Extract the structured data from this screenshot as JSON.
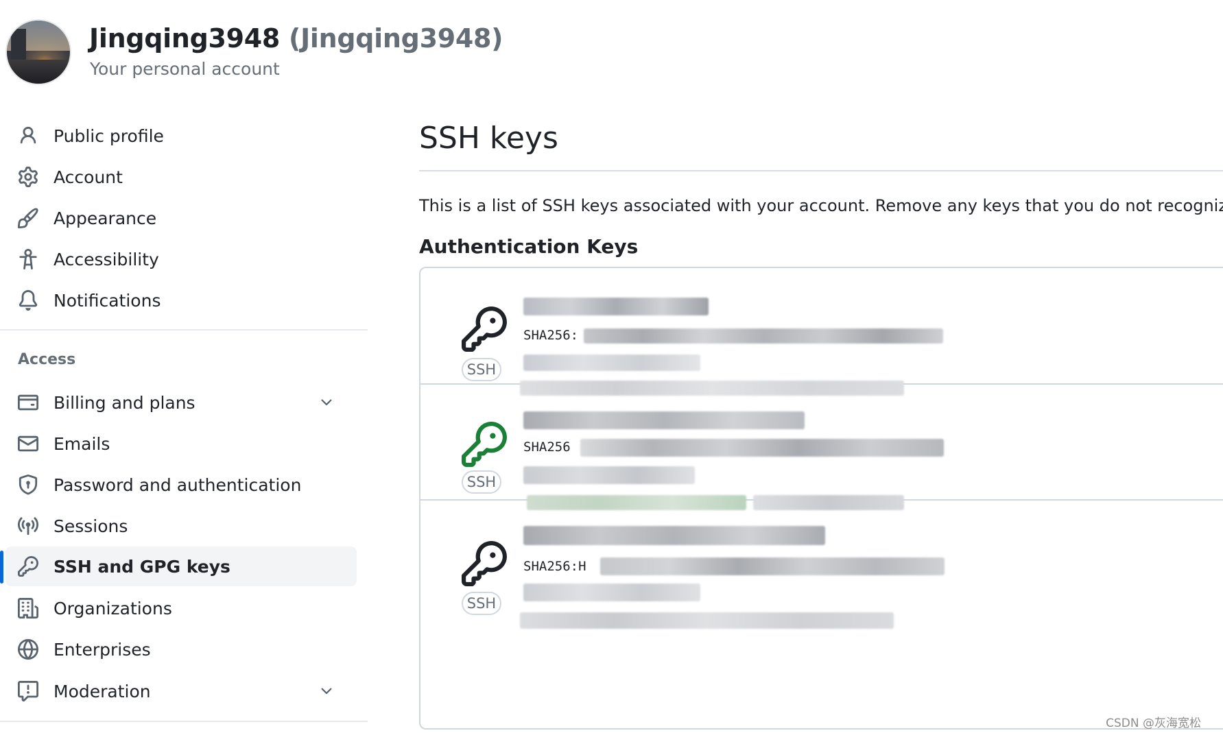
{
  "header": {
    "display_name": "Jingqing3948",
    "login": "(Jingqing3948)",
    "subtitle": "Your personal account"
  },
  "sidebar": {
    "items": [
      {
        "label": "Public profile",
        "icon": "person-icon"
      },
      {
        "label": "Account",
        "icon": "gear-icon"
      },
      {
        "label": "Appearance",
        "icon": "paintbrush-icon"
      },
      {
        "label": "Accessibility",
        "icon": "accessibility-icon"
      },
      {
        "label": "Notifications",
        "icon": "bell-icon"
      }
    ],
    "access_section": {
      "label": "Access",
      "items": [
        {
          "label": "Billing and plans",
          "icon": "credit-card-icon",
          "expandable": true
        },
        {
          "label": "Emails",
          "icon": "mail-icon"
        },
        {
          "label": "Password and authentication",
          "icon": "shield-lock-icon"
        },
        {
          "label": "Sessions",
          "icon": "broadcast-icon"
        },
        {
          "label": "SSH and GPG keys",
          "icon": "key-icon",
          "active": true
        },
        {
          "label": "Organizations",
          "icon": "organization-icon"
        },
        {
          "label": "Enterprises",
          "icon": "globe-icon"
        },
        {
          "label": "Moderation",
          "icon": "report-icon",
          "expandable": true
        }
      ]
    }
  },
  "main": {
    "title": "SSH keys",
    "description": "This is a list of SSH keys associated with your account. Remove any keys that you do not recognize.",
    "section_heading": "Authentication Keys",
    "keys": [
      {
        "type_badge": "SSH",
        "fingerprint_prefix": "SHA256:",
        "status": "inactive",
        "icon_color": "#1f2328"
      },
      {
        "type_badge": "SSH",
        "fingerprint_prefix": "SHA256",
        "status": "recently-used",
        "icon_color": "#1a7f37"
      },
      {
        "type_badge": "SSH",
        "fingerprint_prefix": "SHA256:H",
        "status": "inactive",
        "icon_color": "#1f2328"
      }
    ]
  },
  "colors": {
    "accent": "#0969da",
    "active_key": "#1a7f37",
    "muted_text": "#656d76",
    "border": "#d0d7de"
  },
  "watermark": "CSDN @灰海宽松"
}
